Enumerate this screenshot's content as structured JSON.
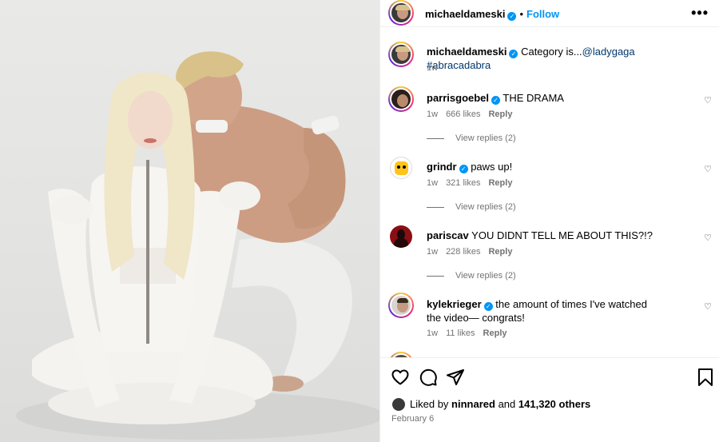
{
  "post": {
    "author": "michaeldameski",
    "follow_label": "Follow",
    "more_label": "•••"
  },
  "caption": {
    "username": "michaeldameski",
    "text": "Category is...",
    "mention": "@ladygaga",
    "hashtag": "#abracadabra",
    "time": "1w"
  },
  "comments": [
    {
      "username": "parrisgoebel",
      "verified": true,
      "text": "THE DRAMA",
      "time": "1w",
      "likes": "666 likes",
      "reply_label": "Reply",
      "view_replies": "View replies (2)"
    },
    {
      "username": "grindr",
      "verified": true,
      "text": "paws up!",
      "time": "1w",
      "likes": "321 likes",
      "reply_label": "Reply",
      "view_replies": "View replies (2)"
    },
    {
      "username": "pariscav",
      "verified": false,
      "text": "YOU DIDNT TELL ME ABOUT THIS?!?",
      "time": "1w",
      "likes": "228 likes",
      "reply_label": "Reply",
      "view_replies": "View replies (2)"
    },
    {
      "username": "kylekrieger",
      "verified": true,
      "text": "the amount of times I've watched the video— congrats!",
      "time": "1w",
      "likes": "11 likes",
      "reply_label": "Reply"
    }
  ],
  "footer": {
    "liked_prefix": "Liked by",
    "liked_user": "ninnared",
    "liked_and": "and",
    "liked_count": "141,320 others",
    "date": "February 6"
  },
  "colors": {
    "accent": "#0095f6",
    "link": "#00376b",
    "meta": "#737373"
  },
  "icons": [
    "verified-badge-icon",
    "heart-icon",
    "comment-icon",
    "share-icon",
    "bookmark-icon",
    "more-icon"
  ]
}
